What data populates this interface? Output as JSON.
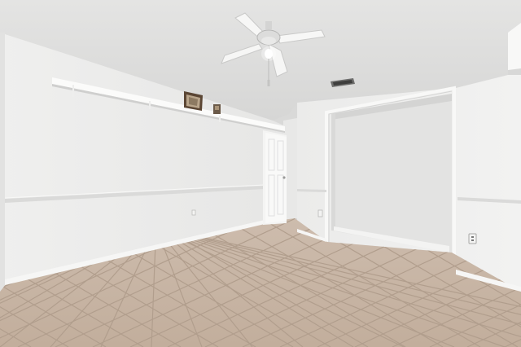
{
  "scene": {
    "kind": "photo",
    "subject": "empty-room",
    "colors": {
      "ceiling": "#dededd",
      "wall_left": "#ececeb",
      "wall_right": "#eeeeed",
      "alcove": "#e4e4e3",
      "floor_tile": "#c7b5a5",
      "grout": "#b09c8b",
      "trim": "#f6f6f5"
    },
    "objects": [
      "ceiling-fan",
      "wall-shelf",
      "picture-frame",
      "small-figurine",
      "interior-door",
      "air-vent",
      "wall-outlet",
      "light-switch",
      "alcove-opening",
      "tile-floor"
    ]
  }
}
